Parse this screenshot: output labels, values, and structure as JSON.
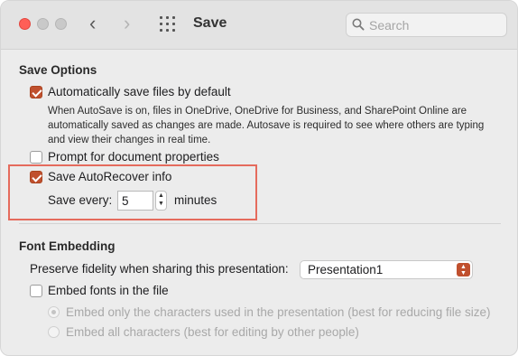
{
  "window": {
    "title": "Save"
  },
  "toolbar": {
    "back_icon": "chevron-left-icon",
    "forward_icon": "chevron-right-icon",
    "grid_icon": "show-all-grid-icon",
    "search": {
      "placeholder": "Search",
      "value": ""
    }
  },
  "save_options": {
    "heading": "Save Options",
    "autosave": {
      "label": "Automatically save files by default",
      "checked": true,
      "description": "When AutoSave is on, files in OneDrive, OneDrive for Business, and SharePoint Online are automatically saved as changes are made. Autosave is required to see where others are typing and view their changes in real time."
    },
    "prompt_properties": {
      "label": "Prompt for document properties",
      "checked": false
    },
    "autorecover": {
      "label": "Save AutoRecover info",
      "checked": true,
      "save_every_label": "Save every:",
      "minutes_value": "5",
      "minutes_label": "minutes"
    }
  },
  "font_embedding": {
    "heading": "Font Embedding",
    "preserve_label": "Preserve fidelity when sharing this presentation:",
    "presentation_select": "Presentation1",
    "embed_fonts": {
      "label": "Embed fonts in the file",
      "checked": false
    },
    "options": [
      {
        "label": "Embed only the characters used in the presentation (best for reducing file size)",
        "selected": true,
        "enabled": false
      },
      {
        "label": "Embed all characters (best for editing by other people)",
        "selected": false,
        "enabled": false
      }
    ]
  },
  "colors": {
    "accent": "#c0502e",
    "highlight_border": "#e56b5d",
    "close_button": "#ff5f57"
  }
}
